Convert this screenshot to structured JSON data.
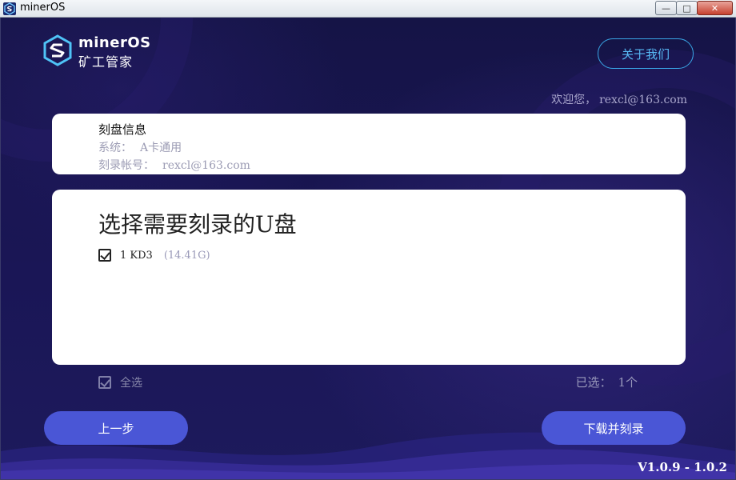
{
  "titlebar": {
    "title": "minerOS",
    "minimize_glyph": "—",
    "maximize_glyph": "□",
    "close_glyph": "✕"
  },
  "logo": {
    "brand": "minerOS",
    "brand_cn": "矿工管家",
    "icon": "hexagon-s-logo"
  },
  "header": {
    "about_label": "关于我们",
    "welcome_prefix": "欢迎您，",
    "welcome_user": "rexcl@163.com"
  },
  "info": {
    "heading": "刻盘信息",
    "system_label": "系统：",
    "system_value": "A卡通用",
    "account_label": "刻录帐号：",
    "account_value": "rexcl@163.com"
  },
  "selection": {
    "heading": "选择需要刻录的U盘",
    "drives": [
      {
        "name": "1 KD3",
        "size": "(14.41G)",
        "checked": true
      }
    ],
    "select_all_label": "全选",
    "selected_label": "已选：",
    "selected_count": "1个"
  },
  "buttons": {
    "prev_label": "上一步",
    "next_label": "下载并刻录"
  },
  "version": "V1.0.9 - 1.0.2",
  "colors": {
    "accent": "#4a56d6",
    "about_border": "#39a6e6",
    "background": "#1a1656"
  }
}
